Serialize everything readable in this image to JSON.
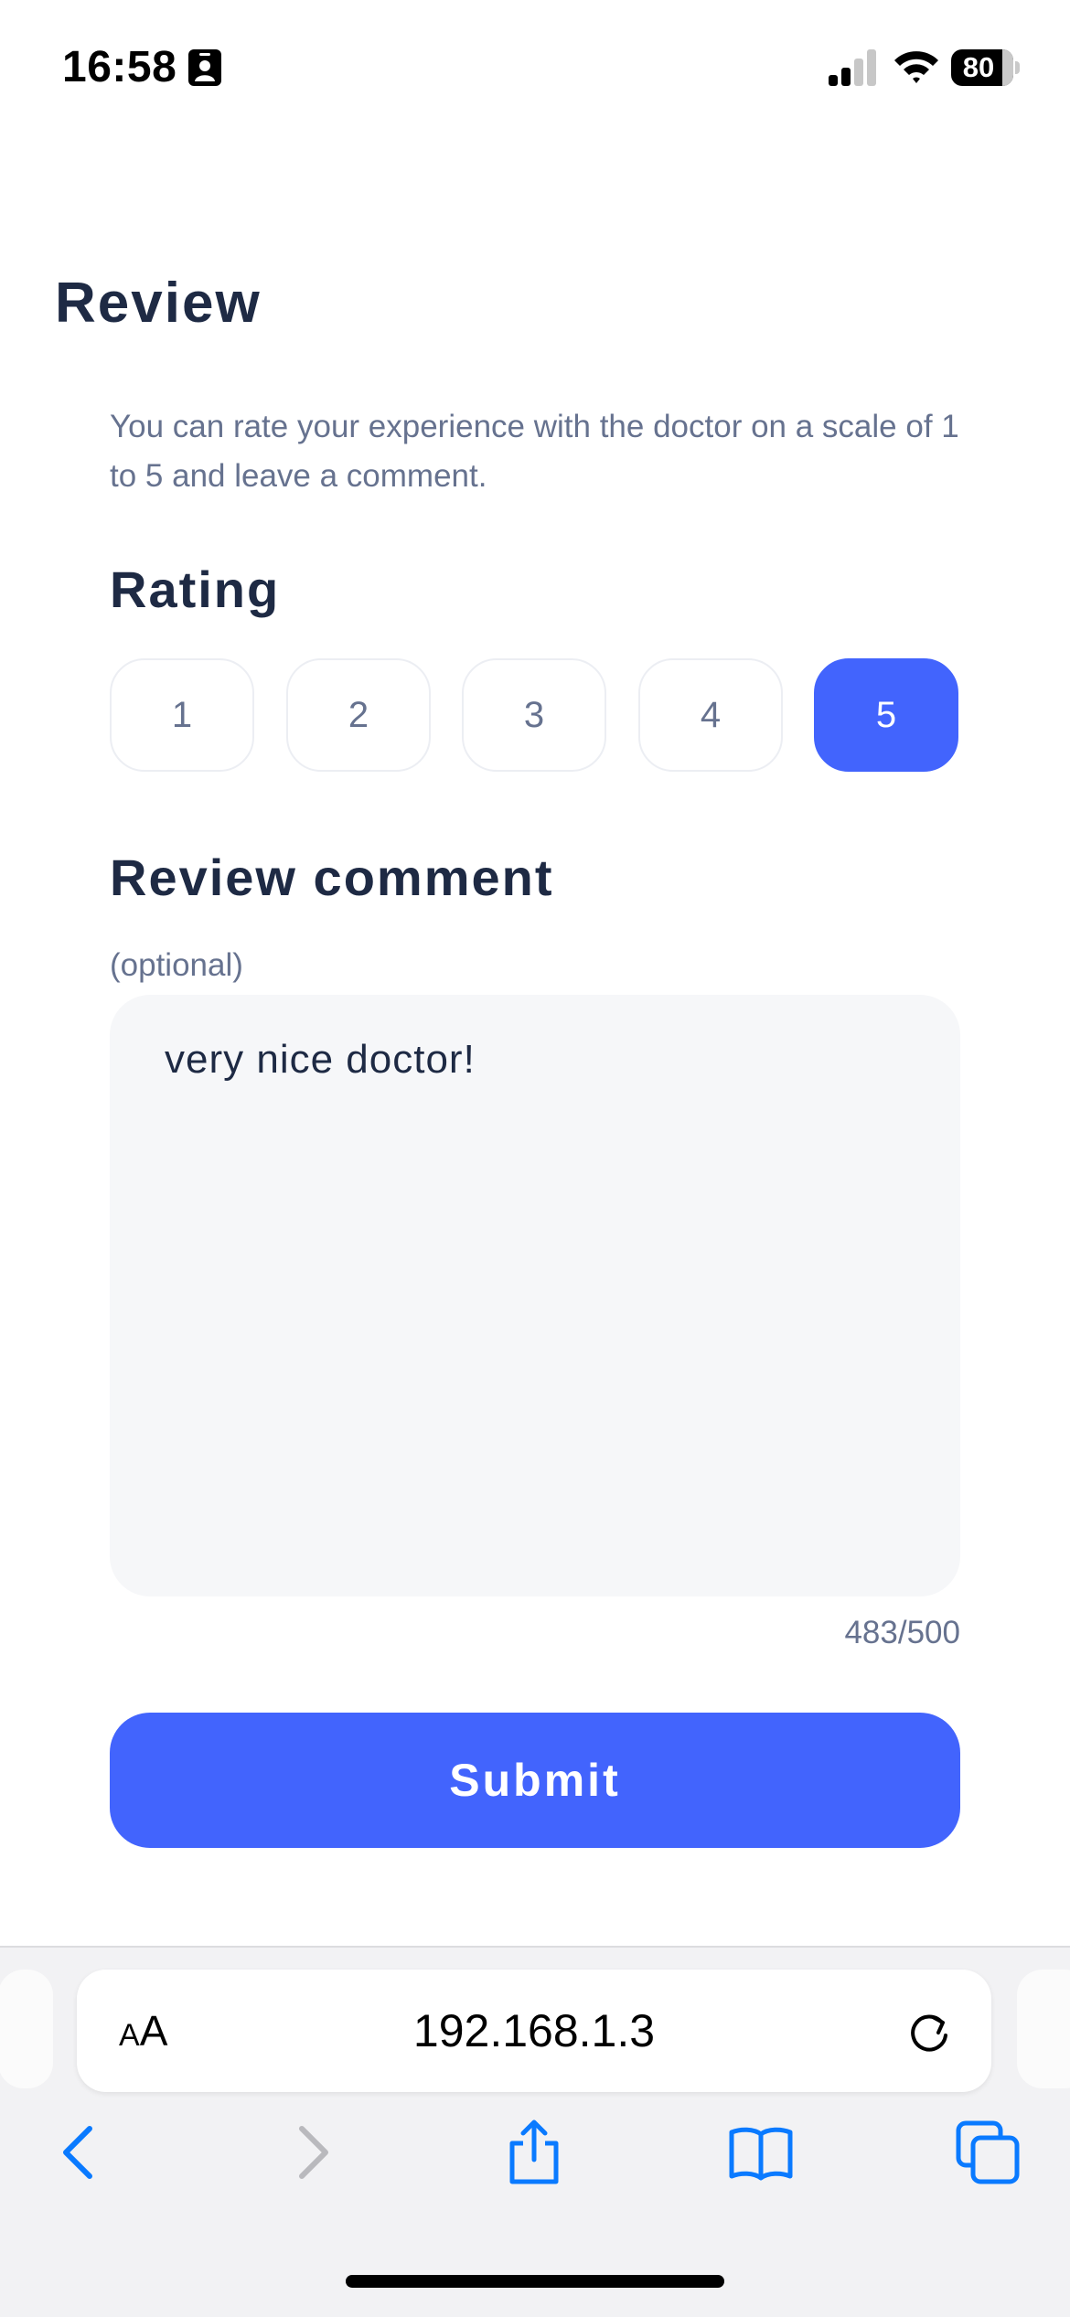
{
  "status_bar": {
    "time": "16:58",
    "battery": "80"
  },
  "page": {
    "title": "Review",
    "intro": "You can rate your experience with the doctor on a scale of 1 to 5 and leave a comment."
  },
  "rating": {
    "title": "Rating",
    "options": [
      "1",
      "2",
      "3",
      "4",
      "5"
    ],
    "selected": "5"
  },
  "comment": {
    "title": "Review comment",
    "optional_label": "(optional)",
    "value": "very nice doctor!",
    "char_count": "483/500"
  },
  "submit_label": "Submit",
  "browser": {
    "aa_small": "A",
    "aa_large": "A",
    "url": "192.168.1.3",
    "toolbar_icons": [
      "back-icon",
      "forward-icon",
      "share-icon",
      "bookmarks-icon",
      "tabs-icon"
    ]
  },
  "colors": {
    "accent": "#4264fd",
    "heading": "#1e2a44",
    "muted": "#66728f",
    "ios_blue": "#0a7aff"
  }
}
